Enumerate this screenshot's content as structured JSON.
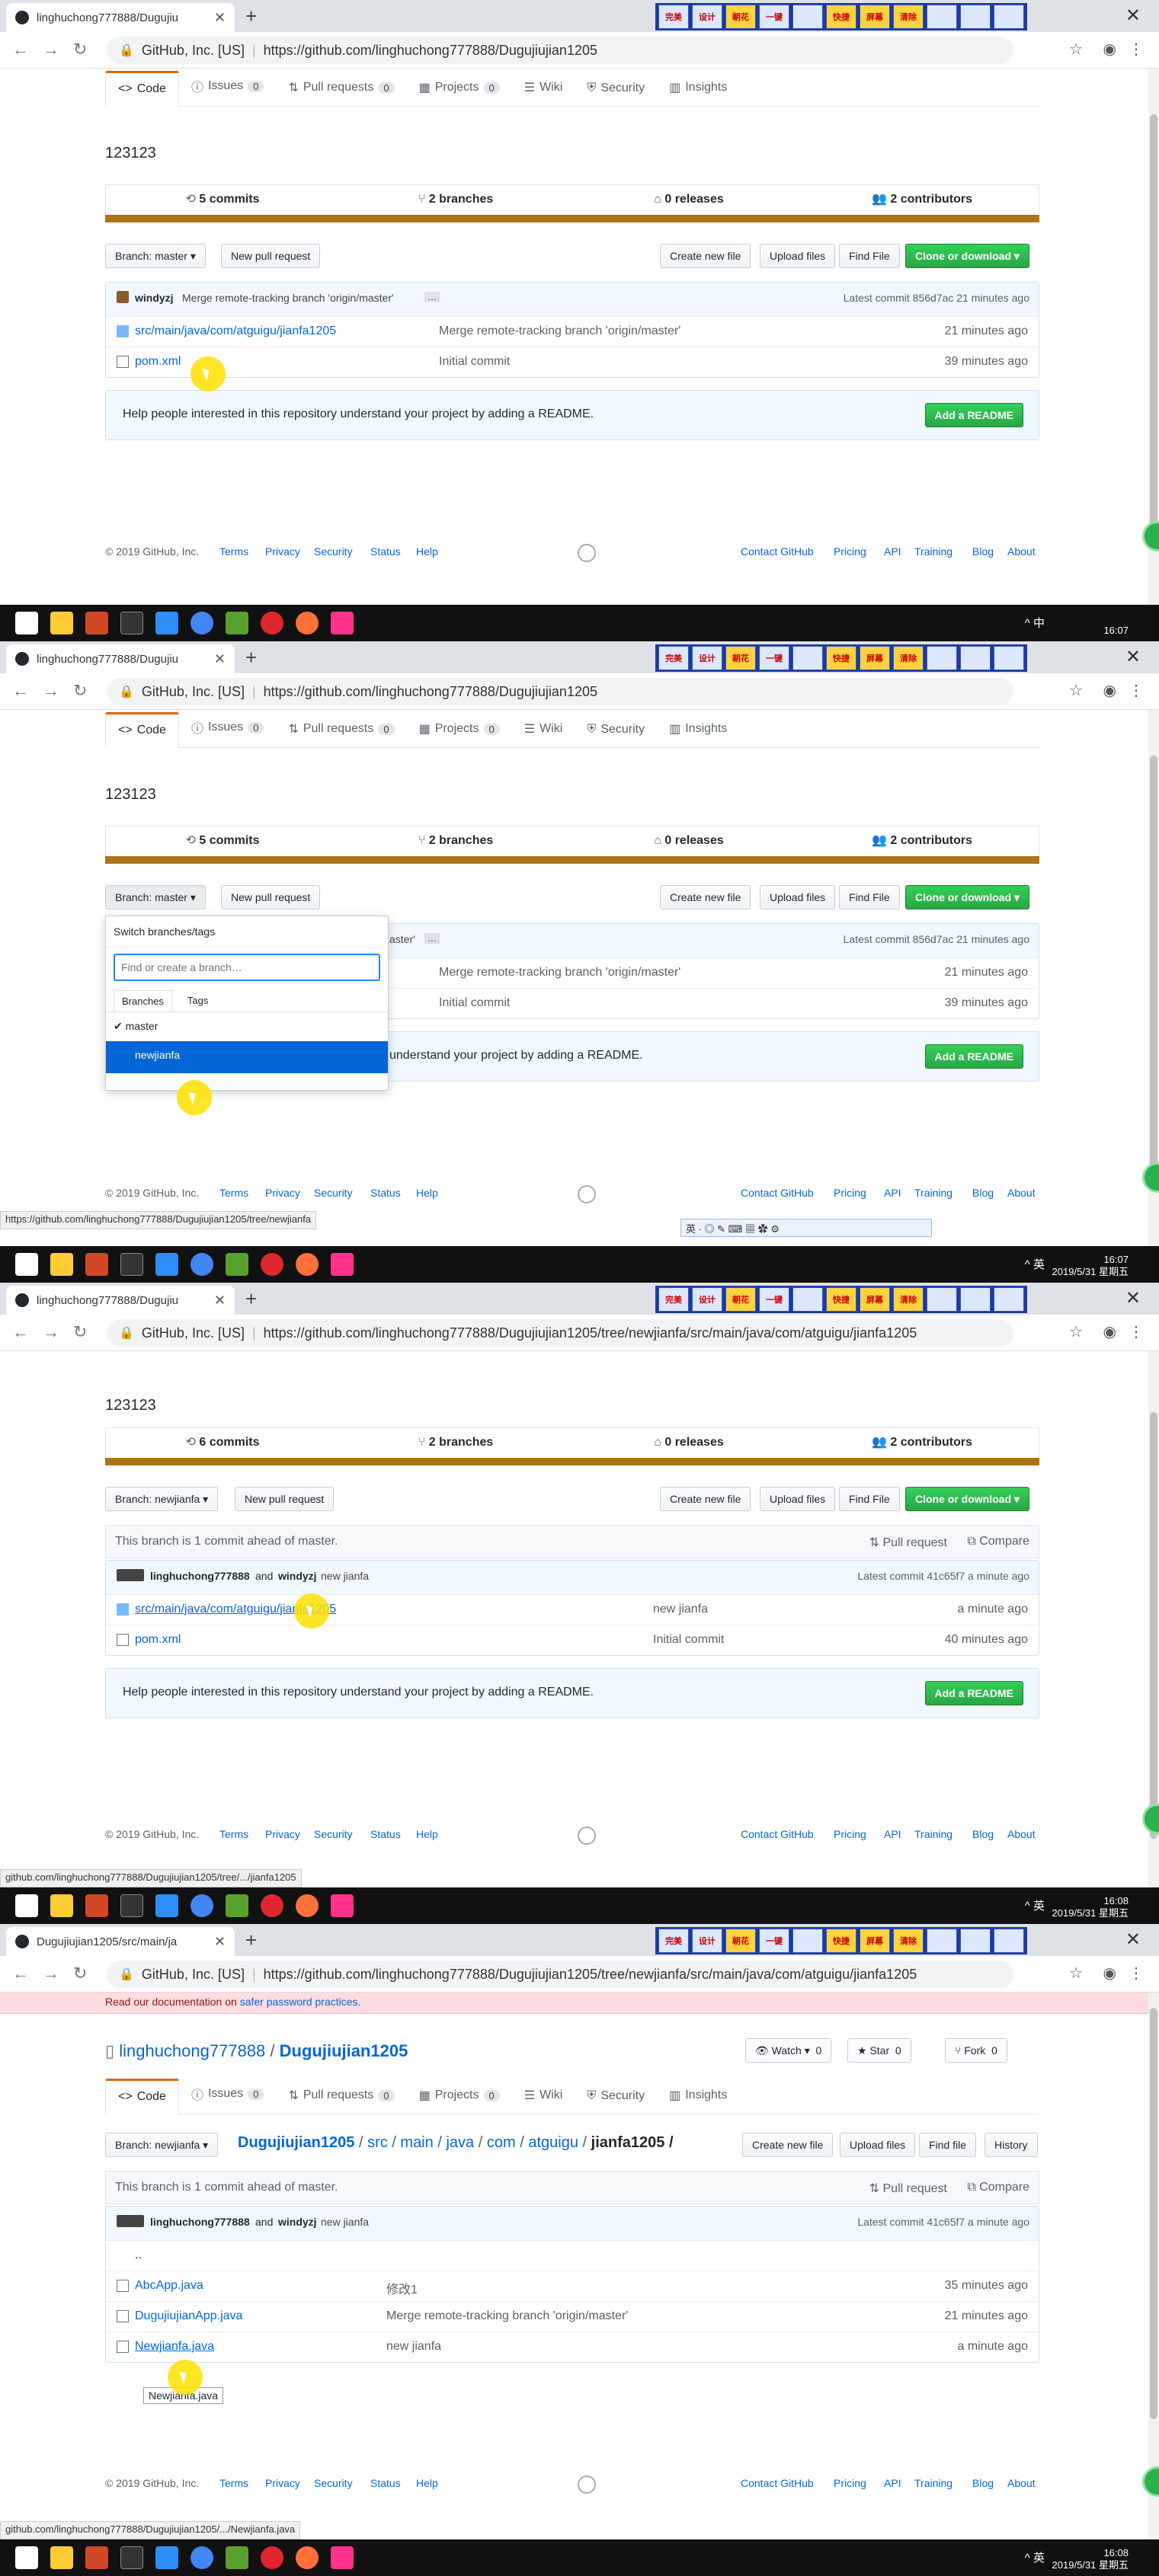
{
  "frames": [
    {
      "tab_title": "linghuchong777888/Dugujiu",
      "url_org": "GitHub, Inc. [US]",
      "url": "https://github.com/linghuchong777888/Dugujiujian1205",
      "status_url": "",
      "clock_time": "16:07",
      "clock_date": "",
      "tray": "^ 中"
    },
    {
      "tab_title": "linghuchong777888/Dugujiu",
      "url_org": "GitHub, Inc. [US]",
      "url": "https://github.com/linghuchong777888/Dugujiujian1205",
      "status_url": "https://github.com/linghuchong777888/Dugujiujian1205/tree/newjianfa",
      "clock_time": "16:07",
      "clock_date": "2019/5/31 星期五",
      "tray": "^ 英"
    },
    {
      "tab_title": "linghuchong777888/Dugujiu",
      "url_org": "GitHub, Inc. [US]",
      "url": "https://github.com/linghuchong777888/Dugujiujian1205/tree/newjianfa/src/main/java/com/atguigu/jianfa1205",
      "status_url": "github.com/linghuchong777888/Dugujiujian1205/tree/.../jianfa1205",
      "clock_time": "16:08",
      "clock_date": "2019/5/31 星期五",
      "tray": "^ 英"
    },
    {
      "tab_title": "Dugujiujian1205/src/main/ja",
      "url_org": "GitHub, Inc. [US]",
      "url": "https://github.com/linghuchong777888/Dugujiujian1205/tree/newjianfa/src/main/java/com/atguigu/jianfa1205",
      "status_url": "github.com/linghuchong777888/Dugujiujian1205/.../Newjianfa.java",
      "clock_time": "16:08",
      "clock_date": "2019/5/31 星期五",
      "tray": "^ 英"
    }
  ],
  "extensions": [
    "完美",
    "设计",
    "朝花",
    "一键",
    "",
    "快捷",
    "屏幕",
    "清除",
    "",
    "",
    ""
  ],
  "reponav": {
    "code": "Code",
    "issues": "Issues",
    "issues_count": "0",
    "pulls": "Pull requests",
    "pulls_count": "0",
    "projects": "Projects",
    "projects_count": "0",
    "wiki": "Wiki",
    "security": "Security",
    "insights": "Insights"
  },
  "description": "123123",
  "summary_main": {
    "commits": "5 commits",
    "branches": "2 branches",
    "releases": "0 releases",
    "contributors": "2 contributors"
  },
  "summary_branch": {
    "commits": "6 commits",
    "branches": "2 branches",
    "releases": "0 releases",
    "contributors": "2 contributors"
  },
  "buttons": {
    "branch_master": "Branch: master ▾",
    "branch_newjianfa": "Branch: newjianfa ▾",
    "new_pr": "New pull request",
    "create_file": "Create new file",
    "upload": "Upload files",
    "find": "Find File",
    "find_lower": "Find file",
    "history": "History",
    "clone": "Clone or download ▾",
    "add_readme": "Add a README"
  },
  "master_commit": {
    "author": "windyzj",
    "message": "Merge remote-tracking branch 'origin/master'",
    "ellipsis": "…",
    "latest": "Latest commit 856d7ac 21 minutes ago"
  },
  "master_files": [
    {
      "name": "src/main/java/com/atguigu/jianfa1205",
      "msg": "Merge remote-tracking branch 'origin/master'",
      "age": "21 minutes ago",
      "type": "dir"
    },
    {
      "name": "pom.xml",
      "msg": "Initial commit",
      "age": "39 minutes ago",
      "type": "file"
    }
  ],
  "readme_text": "Help people interested in this repository understand your project by adding a README.",
  "dropdown": {
    "title": "Switch branches/tags",
    "placeholder": "Find or create a branch…",
    "tab_branches": "Branches",
    "tab_tags": "Tags",
    "item_master": "master",
    "item_newjianfa": "newjianfa",
    "partial_row1": "aster'",
    "partial_readme": "understand your project by adding a README."
  },
  "ahead": {
    "text": "This branch is 1 commit ahead of master.",
    "pull": "Pull request",
    "compare": "Compare"
  },
  "branch_commit": {
    "author1": "linghuchong777888",
    "and": "and",
    "author2": "windyzj",
    "message": "new jianfa",
    "latest": "Latest commit 41c65f7 a minute ago"
  },
  "branch_files": [
    {
      "name": "src/main/java/com/atguigu/jianfa1205",
      "msg": "new jianfa",
      "age": "a minute ago",
      "type": "dir"
    },
    {
      "name": "pom.xml",
      "msg": "Initial commit",
      "age": "40 minutes ago",
      "type": "file"
    }
  ],
  "footer": {
    "copy": "© 2019 GitHub, Inc.",
    "terms": "Terms",
    "privacy": "Privacy",
    "security": "Security",
    "status": "Status",
    "help": "Help",
    "contact": "Contact GitHub",
    "pricing": "Pricing",
    "api": "API",
    "training": "Training",
    "blog": "Blog",
    "about": "About"
  },
  "frame4": {
    "alert_prefix": "Read our documentation on",
    "alert_link": "safer password practices.",
    "owner": "linghuchong777888",
    "slash": "/",
    "repo": "Dugujiujian1205",
    "watch": "Watch ▾",
    "watch_count": "0",
    "star": "Star",
    "star_count": "0",
    "fork": "Fork",
    "fork_count": "0",
    "crumb": [
      "Dugujiujian1205",
      "src",
      "main",
      "java",
      "com",
      "atguigu"
    ],
    "crumb_sep": "/",
    "crumb_current": "jianfa1205 /",
    "up": "..",
    "files": [
      {
        "name": "AbcApp.java",
        "msg": "修改1",
        "age": "35 minutes ago"
      },
      {
        "name": "DugujiujianApp.java",
        "msg": "Merge remote-tracking branch 'origin/master'",
        "age": "21 minutes ago"
      },
      {
        "name": "Newjianfa.java",
        "msg": "new jianfa",
        "age": "a minute ago"
      }
    ],
    "tooltip": "Newjianfa.java"
  },
  "ime_text": "英 · ◎ ✎ ⌨ ▦ ✿ ⚙"
}
